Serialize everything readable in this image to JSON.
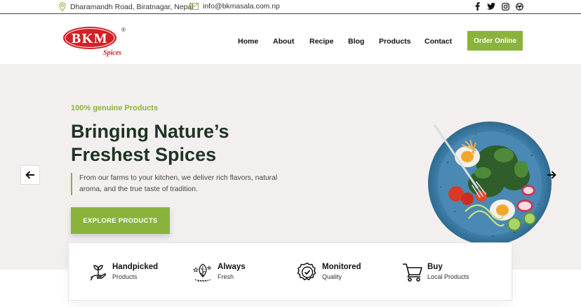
{
  "topbar": {
    "address": "Dharamandh Road, Biratnagar, Nepal",
    "email": "info@bkmasala.com.np",
    "socials": [
      "facebook-icon",
      "twitter-icon",
      "instagram-icon",
      "dribbble-icon"
    ]
  },
  "brand": {
    "logo_text": "BKM",
    "logo_sub": "Spices",
    "registered": "®",
    "colors": {
      "logo_red": "#d32027",
      "accent_green": "#8ab33c",
      "title_dark": "#1e3323",
      "hero_bg": "#f3efef"
    }
  },
  "nav": {
    "items": [
      "Home",
      "About",
      "Recipe",
      "Blog",
      "Products",
      "Contact"
    ],
    "cta": "Order Online"
  },
  "hero": {
    "tagline": "100% genuine Products",
    "title_line1": "Bringing Nature’s",
    "title_line2": "Freshest Spices",
    "description": "From our farms to your kitchen, we deliver rich flavors, natural aroma, and the true taste of tradition.",
    "button": "EXPLORE PRODUCTS"
  },
  "features": [
    {
      "title": "Handpicked",
      "subtitle": "Products",
      "icon": "hand-plant-icon"
    },
    {
      "title": "Always",
      "subtitle": "Fresh",
      "icon": "leaf-drop-icon"
    },
    {
      "title": "Monitored",
      "subtitle": "Quality",
      "icon": "badge-check-icon"
    },
    {
      "title": "Buy",
      "subtitle": "Local Products",
      "icon": "cart-icon"
    }
  ]
}
